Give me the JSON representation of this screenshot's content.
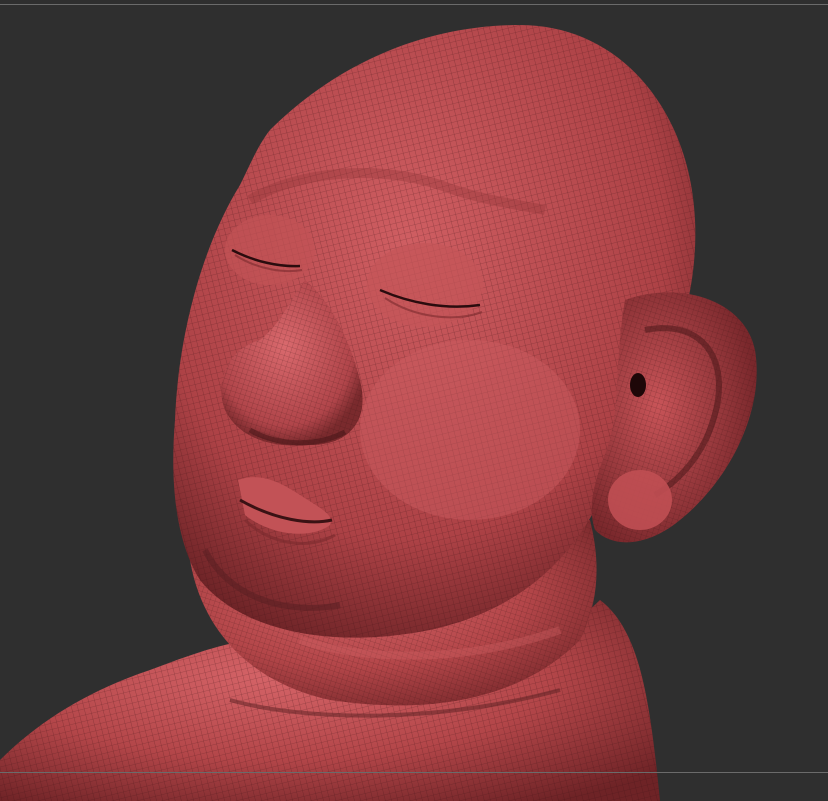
{
  "viewport": {
    "background": "#2f2f2f",
    "guide_color": "#6b6b6b"
  },
  "model": {
    "subject": "sculpted-head",
    "material_color": "#b84a4e",
    "highlight_color": "#d6676b",
    "shadow_color": "#5a1f22",
    "wireframe_color": "#3a1214",
    "wireframe": true
  }
}
